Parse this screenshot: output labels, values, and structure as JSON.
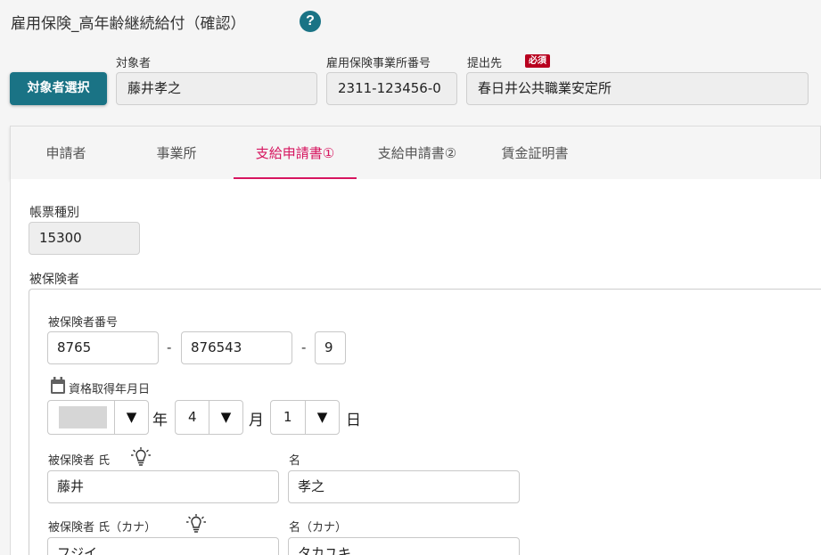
{
  "header": {
    "title": "雇用保険_高年齢継続給付（確認）",
    "help_glyph": "?"
  },
  "target": {
    "select_button_label": "対象者選択",
    "person_label": "対象者",
    "person_value": "藤井孝之",
    "office_number_label": "雇用保険事業所番号",
    "office_number_value": "2311-123456-0",
    "destination_label": "提出先",
    "required_badge": "必須",
    "destination_value": "春日井公共職業安定所"
  },
  "tabs": [
    {
      "label": "申請者",
      "active": false
    },
    {
      "label": "事業所",
      "active": false
    },
    {
      "label": "支給申請書①",
      "active": true
    },
    {
      "label": "支給申請書②",
      "active": false
    },
    {
      "label": "賃金証明書",
      "active": false
    }
  ],
  "form": {
    "form_type_label": "帳票種別",
    "form_type_value": "15300",
    "insured_section_label": "被保険者",
    "insured_number_label": "被保険者番号",
    "insured_number": {
      "part1": "8765",
      "sep1": "-",
      "part2": "876543",
      "sep2": "-",
      "part3": "9"
    },
    "qualification_date_label": "資格取得年月日",
    "date": {
      "era_value": "",
      "year_unit": "年",
      "month_value": "4",
      "month_unit": "月",
      "day_value": "1",
      "day_unit": "日",
      "arrow_glyph": "▼"
    },
    "surname_label": "被保険者 氏",
    "surname_value": "藤井",
    "given_name_label": "名",
    "given_name_value": "孝之",
    "surname_kana_label": "被保険者 氏（カナ）",
    "surname_kana_value": "フジイ",
    "given_name_kana_label": "名（カナ）",
    "given_name_kana_value": "タカユキ"
  },
  "colors": {
    "primary": "#1a7385",
    "active_tab": "#d6155f",
    "required": "#b8001f"
  }
}
